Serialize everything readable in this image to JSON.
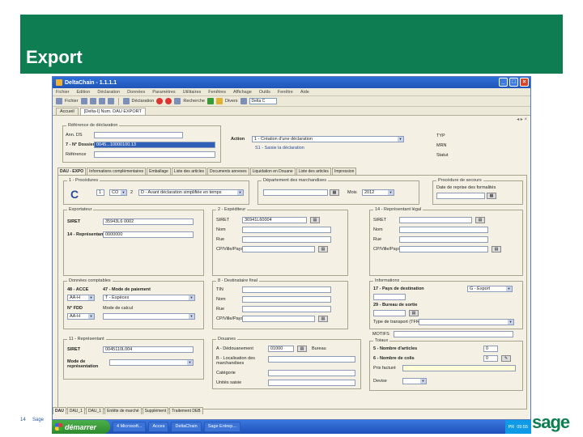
{
  "slide": {
    "title": "Export",
    "page_number": "14",
    "footer": "Sage",
    "brand": "sage"
  },
  "app": {
    "title": "DeltaChain - 1.1.1.1",
    "menu": [
      "Fichier",
      "Edition",
      "Déclaration",
      "Données",
      "Paramètres",
      "Utilitaires",
      "Fenêtres",
      "Affichage",
      "Outils",
      "Fenêtre",
      "Aide"
    ],
    "toolbar": {
      "file_label": "Fichier",
      "decl_label": "Déclaration",
      "search_label": "Recherche",
      "divers_label": "Divers",
      "combo_value": "Delta C"
    },
    "doc_tabs": [
      "Accueil",
      "[Delta-I] Num. DAU EXPORT"
    ],
    "header": {
      "group_title": "Référence de déclaration",
      "num_label": "Ann. DS",
      "num_value": "",
      "ref_label": "7 - N° Dossier",
      "ref_value": "0045...10000100.13",
      "ref2_label": "Référence",
      "ref2_value": "",
      "action_label": "Action",
      "action_value": "1 - Création d'une déclaration",
      "action_sub": "S1 - Saisie la déclaration",
      "typ_label": "TYP",
      "mrn_label": "MRN",
      "statut_label": "Statut"
    },
    "subtabs": [
      "DAU - EXPO",
      "Informations complémentaires",
      "Emballage",
      "Liste des articles",
      "Documents annexes",
      "Liquidation en Douane",
      "Liste des articles",
      "Impression"
    ],
    "sections": {
      "s1": {
        "title": "1 - Procédures",
        "letter": "C",
        "sel1": "1",
        "sel2": "CO",
        "sel3": "2",
        "combo": "D - Avant déclaration simplifiée en temps"
      },
      "dep": {
        "title": "Département des marchandises",
        "mois_label": "Mois",
        "mois_value": "2012"
      },
      "sec": {
        "title": "Procédure de secours",
        "label": "Date de reprise des formalités"
      },
      "s2": {
        "title": "Exportateur",
        "siret_label": "SIRET",
        "siret_value": "35943L6 0002",
        "nom_label": "14 - Représentant",
        "nom_value": "0000000"
      },
      "s3": {
        "title": "2 - Expéditeur",
        "siret_label": "SIRET",
        "siret_value": "36941L60004",
        "nom_label": "Nom",
        "rue_label": "Rue",
        "cp_label": "CP/Ville/Pays"
      },
      "s4": {
        "title": "14 - Représentant légal",
        "siret_label": "SIRET",
        "nom_label": "Nom",
        "rue_label": "Rue",
        "cp_label": "CP/Ville/Pays"
      },
      "s5": {
        "title": "Données comptables",
        "p1_label": "48 - ACCE",
        "p1_value": "AA-H",
        "p2_label": "47 - Mode de paiement",
        "p2_value": "T - Espèces",
        "nfr_label": "N° FDD",
        "nfr_value": "AA-H",
        "mode_label": "Mode de calcul"
      },
      "s6": {
        "title": "8 - Destinataire final",
        "tin_label": "TIN",
        "nom_label": "Nom",
        "rue_label": "Rue",
        "cp_label": "CP/Ville/Pays"
      },
      "s7": {
        "title": "Informations",
        "pays_label": "17 - Pays de destination",
        "pays_value": "G - Export",
        "num_label": "29 - Bureau de sortie",
        "pays2_label": "Type de transport (TFR)",
        "mot_label": "MOTIFS"
      },
      "s8": {
        "title": "11 - Représentant",
        "siret_label": "SIRET",
        "siret_value": "0045110L004",
        "mode_label": "Mode de représentation"
      },
      "s9": {
        "title": "Douanes",
        "d1_label": "A - Dédouanement",
        "d1_value": "01000",
        "d1_sub": "Bureau",
        "d2_label": "B - Localisation des marchandises",
        "d3_label": "Catégorie",
        "d4_label": "Unités saisie"
      },
      "s10": {
        "title": "Totaux",
        "t1_label": "5 - Nombre d'articles",
        "t1_value": "0",
        "t2_label": "6 - Nombre de colis",
        "t2_value": "0",
        "t3_label": "Prix facturé",
        "t4_label": "Devise"
      }
    },
    "bottom_tabs": [
      "DAU",
      "DAU_1",
      "DAU_1",
      "Entête de marché",
      "Supplément",
      "Traitement DEB"
    ]
  },
  "taskbar": {
    "start": "démarrer",
    "tasks": [
      "4 Microsoft...",
      "Acces",
      "DeltaChain",
      "Sage Entrep...",
      "PR"
    ],
    "clock": "09:55"
  }
}
